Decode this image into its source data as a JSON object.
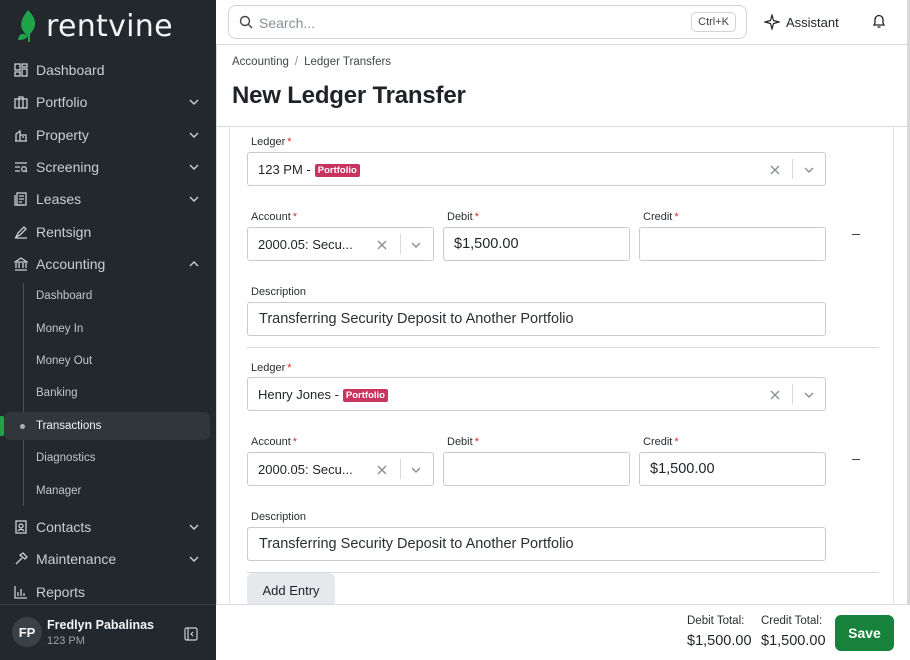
{
  "brand": {
    "name": "rentvine",
    "accent": "#1ea34a"
  },
  "sidebar": {
    "items": [
      {
        "label": "Dashboard",
        "icon": "dashboard-icon",
        "expandable": false
      },
      {
        "label": "Portfolio",
        "icon": "portfolio-icon",
        "expandable": true
      },
      {
        "label": "Property",
        "icon": "property-icon",
        "expandable": true
      },
      {
        "label": "Screening",
        "icon": "screening-icon",
        "expandable": true
      },
      {
        "label": "Leases",
        "icon": "leases-icon",
        "expandable": true
      },
      {
        "label": "Rentsign",
        "icon": "rentsign-icon",
        "expandable": false
      },
      {
        "label": "Accounting",
        "icon": "bank-icon",
        "expandable": true,
        "expanded": true
      },
      {
        "label": "Contacts",
        "icon": "contacts-icon",
        "expandable": true
      },
      {
        "label": "Maintenance",
        "icon": "hammer-icon",
        "expandable": true
      },
      {
        "label": "Reports",
        "icon": "reports-icon",
        "expandable": false
      }
    ],
    "accounting_sub": [
      "Dashboard",
      "Money In",
      "Money Out",
      "Banking",
      "Transactions",
      "Diagnostics",
      "Manager"
    ],
    "active_sub": "Transactions"
  },
  "user": {
    "initials": "FP",
    "name": "Fredlyn Pabalinas",
    "company": "123 PM"
  },
  "topbar": {
    "search_placeholder": "Search...",
    "shortcut": "Ctrl+K",
    "assistant_label": "Assistant"
  },
  "breadcrumb": [
    "Accounting",
    "Ledger Transfers"
  ],
  "page_title": "New Ledger Transfer",
  "labels": {
    "ledger": "Ledger",
    "account": "Account",
    "debit": "Debit",
    "credit": "Credit",
    "description": "Description",
    "required_mark": "*"
  },
  "entries": [
    {
      "ledger": "123 PM -",
      "ledger_badge": "Portfolio",
      "account": "2000.05: Secu...",
      "debit": "$1,500.00",
      "credit": "",
      "description": "Transferring Security Deposit to Another Portfolio",
      "remove": "–"
    },
    {
      "ledger": "Henry Jones -",
      "ledger_badge": "Portfolio",
      "account": "2000.05: Secu...",
      "debit": "",
      "credit": "$1,500.00",
      "description": "Transferring Security Deposit to Another Portfolio",
      "remove": "–"
    }
  ],
  "add_entry_label": "Add Entry",
  "footer": {
    "debit_total_label": "Debit Total:",
    "debit_total": "$1,500.00",
    "credit_total_label": "Credit Total:",
    "credit_total": "$1,500.00",
    "save_label": "Save"
  }
}
